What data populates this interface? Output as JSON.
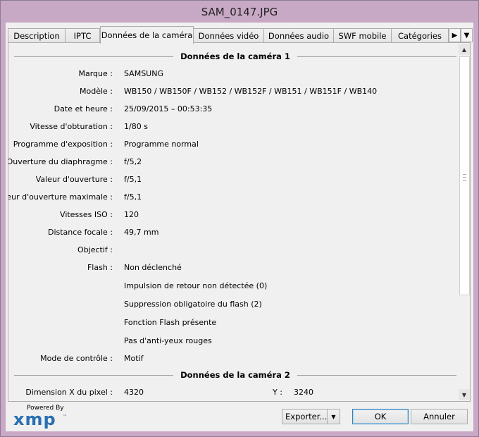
{
  "window": {
    "title": "SAM_0147.JPG"
  },
  "tabs": [
    {
      "label": "Description",
      "active": false
    },
    {
      "label": "IPTC",
      "active": false
    },
    {
      "label": "Données de la caméra",
      "active": true
    },
    {
      "label": "Données vidéo",
      "active": false
    },
    {
      "label": "Données audio",
      "active": false
    },
    {
      "label": "SWF mobile",
      "active": false
    },
    {
      "label": "Catégories",
      "active": false
    }
  ],
  "sections": {
    "camera1": "Données de la caméra 1",
    "camera2": "Données de la caméra 2"
  },
  "fields": [
    {
      "label": "Marque :",
      "value": "SAMSUNG"
    },
    {
      "label": "Modèle :",
      "value": "WB150 / WB150F / WB152 / WB152F / WB151 / WB151F / WB140"
    },
    {
      "label": "Date et heure :",
      "value": "25/09/2015 – 00:53:35"
    },
    {
      "label": "Vitesse d'obturation :",
      "value": "1/80 s"
    },
    {
      "label": "Programme d'exposition :",
      "value": "Programme normal"
    },
    {
      "label": "Ouverture du diaphragme :",
      "value": "f/5,2"
    },
    {
      "label": "Valeur d'ouverture :",
      "value": "f/5,1"
    },
    {
      "label": "Valeur d'ouverture maximale :",
      "value": "f/5,1"
    },
    {
      "label": "Vitesses ISO :",
      "value": "120"
    },
    {
      "label": "Distance focale :",
      "value": "49,7 mm"
    },
    {
      "label": "Objectif :",
      "value": ""
    },
    {
      "label": "Flash :",
      "value": "Non déclenché"
    },
    {
      "label": "",
      "value": "Impulsion de retour non détectée (0)"
    },
    {
      "label": "",
      "value": "Suppression obligatoire du flash (2)"
    },
    {
      "label": "",
      "value": "Fonction Flash présente"
    },
    {
      "label": "",
      "value": "Pas d'anti-yeux rouges"
    },
    {
      "label": "Mode de contrôle :",
      "value": "Motif"
    }
  ],
  "camera2": {
    "pixel_x_label": "Dimension X du pixel :",
    "pixel_x_value": "4320",
    "pixel_y_label": "Y :",
    "pixel_y_value": "3240"
  },
  "footer": {
    "powered_by": "Powered By",
    "logo": "xmp",
    "export_label": "Exporter...",
    "ok_label": "OK",
    "cancel_label": "Annuler"
  },
  "scrollbar": {
    "position": 0.0
  }
}
